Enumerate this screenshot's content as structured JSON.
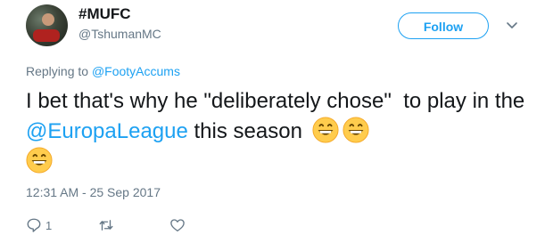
{
  "user": {
    "name": "#MUFC",
    "handle": "@TshumanMC"
  },
  "follow_label": "Follow",
  "reply": {
    "prefix": "Replying to ",
    "to": "@FootyAccums"
  },
  "tweet": {
    "text_before": "I bet that's why he \"deliberately chose\"  to play in the ",
    "mention": "@EuropaLeague",
    "text_after": " this season ",
    "emoji": "grinning-face-icon",
    "emoji_count": 3
  },
  "timestamp": "12:31 AM - 25 Sep 2017",
  "actions": {
    "reply_count": "1"
  },
  "colors": {
    "accent": "#1da1f2",
    "muted": "#657786",
    "text": "#14171a"
  }
}
